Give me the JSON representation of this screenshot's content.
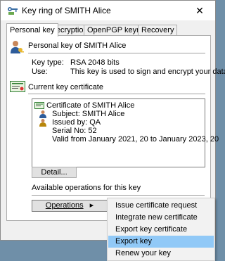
{
  "window": {
    "title": "Key ring of SMITH Alice",
    "close_glyph": "✕"
  },
  "tabs": [
    "Personal key",
    "Decryption",
    "OpenPGP keyring",
    "Recovery"
  ],
  "personal_key": {
    "heading": "Personal key of SMITH Alice",
    "key_type_label": "Key type:",
    "key_type_value": "RSA 2048 bits",
    "use_label": "Use:",
    "use_value": "This key is used to sign and encrypt your data"
  },
  "certificate": {
    "heading": "Current key certificate",
    "title": "Certificate of SMITH Alice",
    "subject": "Subject: SMITH Alice",
    "issued_by": "Issued by: QA",
    "serial": "Serial No: 52",
    "validity": "Valid from January 2021, 20 to January 2023, 20",
    "detail_button": "Detail..."
  },
  "operations": {
    "label": "Available operations for this key",
    "button": "Operations",
    "arrow": "▸"
  },
  "menu": {
    "items": [
      "Issue certificate request",
      "Integrate new certificate",
      "Export key certificate",
      "Export key",
      "Renew your key"
    ],
    "highlighted_index": 3
  },
  "colors": {
    "highlight": "#91c9f7",
    "desktop": "#6f8fa8"
  }
}
